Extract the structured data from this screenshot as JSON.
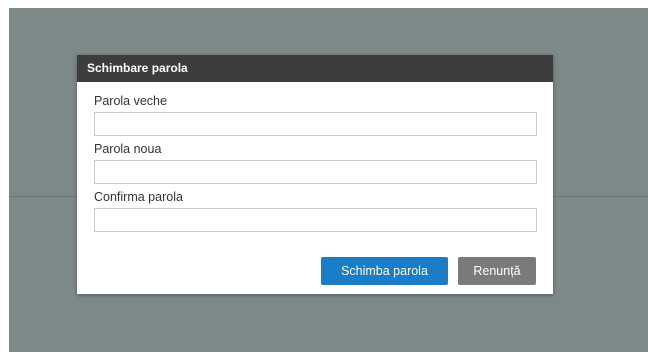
{
  "dialog": {
    "title": "Schimbare parola",
    "fields": [
      {
        "label": "Parola veche",
        "value": "",
        "placeholder": ""
      },
      {
        "label": "Parola noua",
        "value": "",
        "placeholder": ""
      },
      {
        "label": "Confirma parola",
        "value": "",
        "placeholder": ""
      }
    ],
    "buttons": {
      "submit_label": "Schimba parola",
      "cancel_label": "Renunță"
    }
  },
  "colors": {
    "overlay": "#7d8888",
    "header": "#3d3d3d",
    "primary": "#1a7dc7",
    "secondary": "#7a7a7a"
  }
}
